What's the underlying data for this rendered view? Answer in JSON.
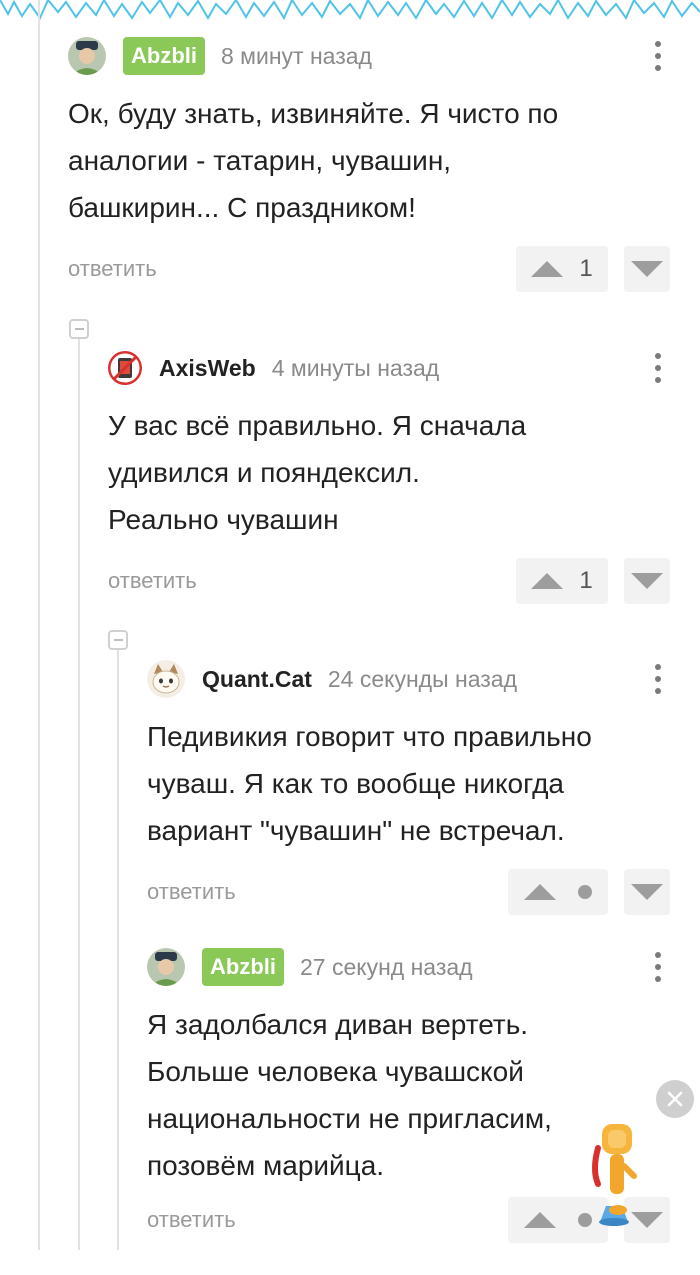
{
  "comments": [
    {
      "username": "Abzbli",
      "time": "8 минут назад",
      "text": "Ок, буду знать, извиняйте. Я чисто по\nаналогии - татарин, чувашин,\nбашкирин... С праздником!",
      "reply_label": "ответить",
      "score": "1"
    },
    {
      "username": "AxisWeb",
      "time": "4 минуты назад",
      "text": "У вас всё правильно. Я сначала\nудивился и пояндексил.\nРеально чувашин",
      "reply_label": "ответить",
      "score": "1"
    },
    {
      "username": "Quant.Cat",
      "time": "24 секунды назад",
      "text": "Педивикия говорит что правильно\nчуваш. Я как то вообще никогда\nвариант \"чувашин\" не встречал.",
      "reply_label": "ответить"
    },
    {
      "username": "Abzbli",
      "time": "27 секунд назад",
      "text": "Я задолбался диван вертеть.\nБольше человека чувашской\nнациональности не пригласим,\nпозовём марийца.",
      "reply_label": "ответить"
    }
  ],
  "icons": {
    "upvote": "arrow-up-icon",
    "downvote": "arrow-down-icon",
    "more": "more-vertical-icon",
    "collapse": "minus-square-icon",
    "close": "close-icon"
  },
  "colors": {
    "badge": "#8ac858",
    "accent_line": "#4fc3e8",
    "muted": "#9a9a9a"
  }
}
